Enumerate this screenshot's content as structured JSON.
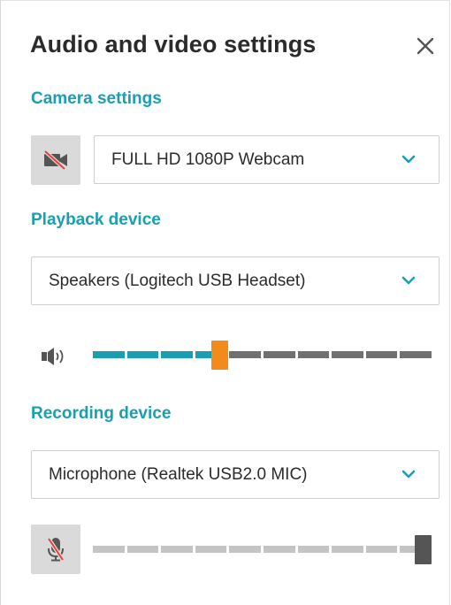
{
  "dialog": {
    "title": "Audio and video settings"
  },
  "camera": {
    "section_label": "Camera settings",
    "device": "FULL HD 1080P Webcam",
    "muted": true
  },
  "playback": {
    "section_label": "Playback device",
    "device": "Speakers (Logitech USB Headset)",
    "volume": {
      "segments": 10,
      "level": 0.375
    }
  },
  "recording": {
    "section_label": "Recording device",
    "device": "Microphone (Realtek USB2.0 MIC)",
    "muted": true,
    "volume": {
      "segments": 10,
      "level": 1.0
    }
  },
  "icons": [
    "close-icon",
    "camera-off-icon",
    "chevron-down-icon",
    "speaker-icon",
    "microphone-off-icon"
  ],
  "colors": {
    "accent": "#1a9fb0",
    "thumb_active": "#f28a1c",
    "thumb_muted": "#555555",
    "track_active": "#1a9fb0",
    "track_inactive": "#707070",
    "track_muted": "#c4c4c4"
  }
}
